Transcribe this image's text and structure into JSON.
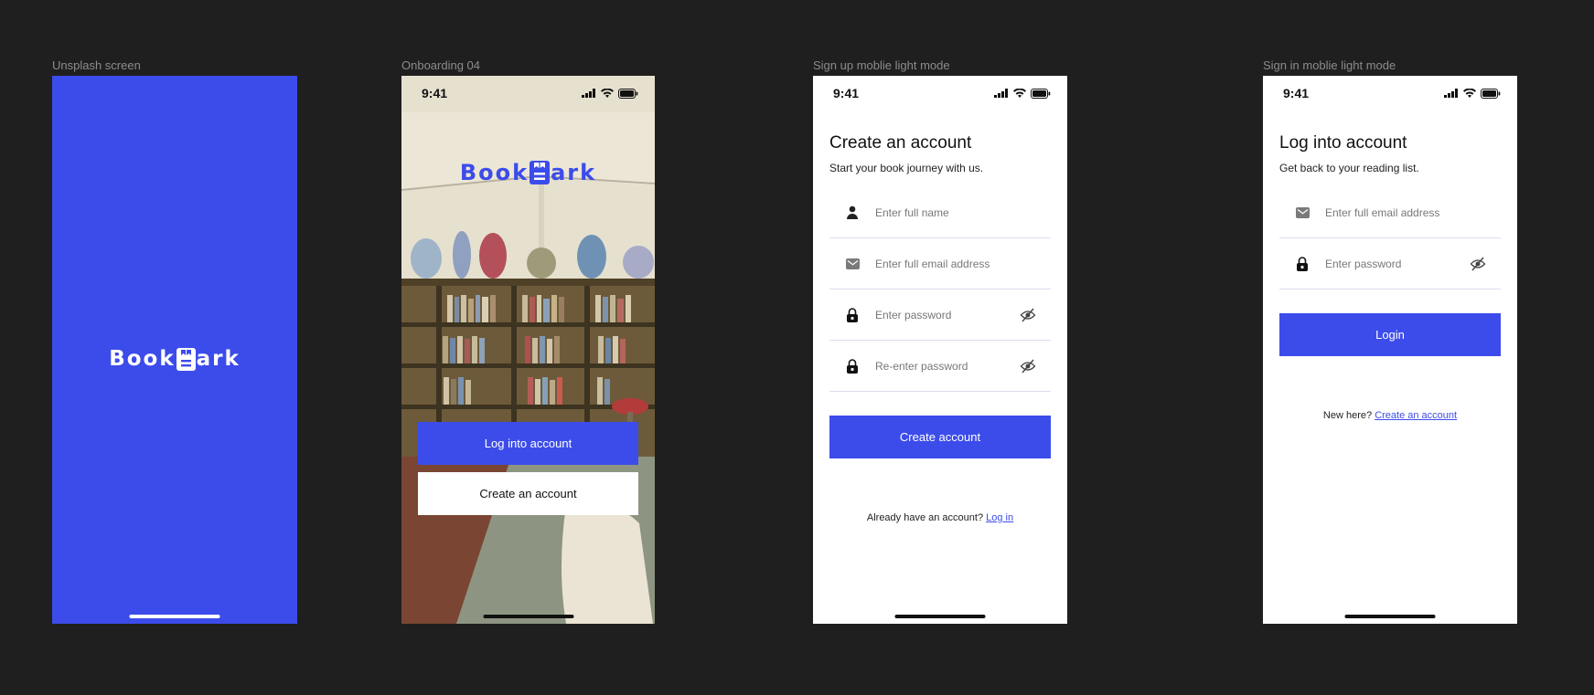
{
  "frames": {
    "splash_label": "Unsplash screen",
    "onboarding_label": "Onboarding 04",
    "signup_label": "Sign up moblie light mode",
    "signin_label": "Sign in moblie light mode"
  },
  "brand": {
    "name_left": "Book",
    "name_right": "ark",
    "primary_color": "#3c4cea",
    "background_color": "#1f1f1f"
  },
  "status_bar": {
    "time": "9:41"
  },
  "onboarding": {
    "login_button": "Log into account",
    "create_button": "Create an account"
  },
  "signup": {
    "title": "Create an account",
    "subtitle": "Start your book journey with us.",
    "fields": {
      "name_placeholder": "Enter full name",
      "email_placeholder": "Enter full email address",
      "password_placeholder": "Enter password",
      "reenter_placeholder": "Re-enter password"
    },
    "submit_label": "Create account",
    "footer_text": "Already have an account?",
    "footer_link": "Log in"
  },
  "signin": {
    "title": "Log into account",
    "subtitle": "Get back to your reading list.",
    "fields": {
      "email_placeholder": "Enter full email address",
      "password_placeholder": "Enter password"
    },
    "submit_label": "Login",
    "footer_text": "New here?",
    "footer_link": "Create an account"
  }
}
